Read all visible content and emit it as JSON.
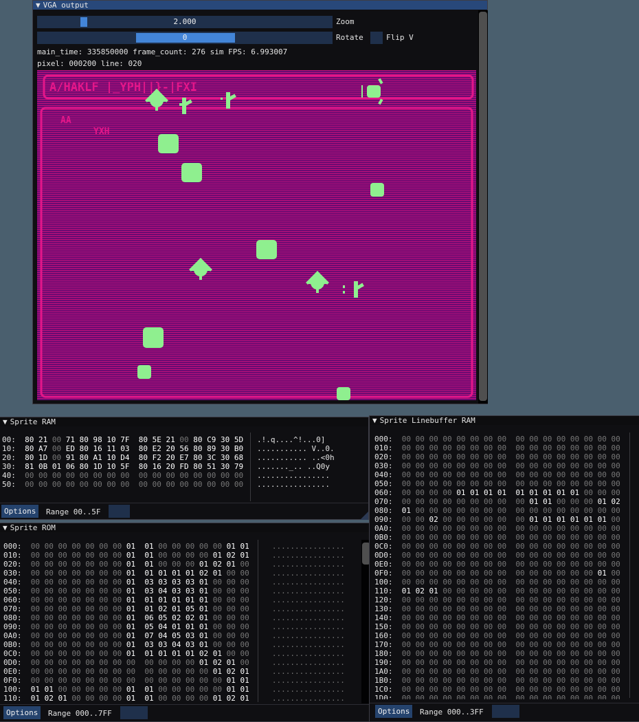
{
  "vga": {
    "title": "VGA output",
    "zoom_value": "2.000",
    "zoom_label": "Zoom",
    "rotate_value": "0",
    "rotate_label": "Rotate",
    "flip_label": "Flip V",
    "status_line": "main_time: 335850000 frame_count: 276 sim FPS: 6.993007",
    "pixel_line": "pixel: 000200 line: 020",
    "header_text": "A/HAKLF |_YPH||}-|FXI",
    "subtext1": "AA",
    "subtext2": "YXH",
    "colors": {
      "bg": "#7a0f6a",
      "border": "#d4147a",
      "sprite": "#8fef8f"
    }
  },
  "sprite_ram": {
    "title": "Sprite RAM",
    "rows": [
      {
        "addr": "00:",
        "bytes": [
          "80",
          "21",
          "00",
          "71",
          "80",
          "98",
          "10",
          "7F",
          "80",
          "5E",
          "21",
          "00",
          "80",
          "C9",
          "30",
          "5D"
        ],
        "ascii": ".!.q....^!...0]"
      },
      {
        "addr": "10:",
        "bytes": [
          "80",
          "A7",
          "00",
          "ED",
          "80",
          "16",
          "11",
          "03",
          "80",
          "E2",
          "20",
          "56",
          "80",
          "89",
          "30",
          "B0"
        ],
        "ascii": "........... V..0."
      },
      {
        "addr": "20:",
        "bytes": [
          "80",
          "1D",
          "00",
          "91",
          "80",
          "A1",
          "10",
          "D4",
          "80",
          "F2",
          "20",
          "E7",
          "80",
          "3C",
          "30",
          "68"
        ],
        "ascii": "........... ..<0h"
      },
      {
        "addr": "30:",
        "bytes": [
          "81",
          "0B",
          "01",
          "06",
          "80",
          "1D",
          "10",
          "5F",
          "80",
          "16",
          "20",
          "FD",
          "80",
          "51",
          "30",
          "79"
        ],
        "ascii": "......._.. ..Q0y"
      },
      {
        "addr": "40:",
        "bytes": [
          "00",
          "00",
          "00",
          "00",
          "00",
          "00",
          "00",
          "00",
          "00",
          "00",
          "00",
          "00",
          "00",
          "00",
          "00",
          "00"
        ],
        "ascii": "................"
      },
      {
        "addr": "50:",
        "bytes": [
          "00",
          "00",
          "00",
          "00",
          "00",
          "00",
          "00",
          "00",
          "00",
          "00",
          "00",
          "00",
          "00",
          "00",
          "00",
          "00"
        ],
        "ascii": "................"
      }
    ],
    "options_label": "Options",
    "range_label": "Range 00..5F"
  },
  "sprite_rom": {
    "title": "Sprite ROM",
    "rows": [
      {
        "addr": "000:",
        "hex": "00 00 00 00 00 00 00 01  01 00 00 00 00 00 01 01",
        "ascii": "................"
      },
      {
        "addr": "010:",
        "hex": "00 00 00 00 00 00 00 01  01 00 00 00 00 01 02 01",
        "ascii": "................"
      },
      {
        "addr": "020:",
        "hex": "00 00 00 00 00 00 00 01  01 00 00 00 01 02 01 00",
        "ascii": "................"
      },
      {
        "addr": "030:",
        "hex": "00 00 00 00 00 00 00 01  01 01 01 01 02 01 00 00",
        "ascii": "................"
      },
      {
        "addr": "040:",
        "hex": "00 00 00 00 00 00 00 01  03 03 03 03 01 00 00 00",
        "ascii": "................"
      },
      {
        "addr": "050:",
        "hex": "00 00 00 00 00 00 00 01  03 04 03 03 01 00 00 00",
        "ascii": "................"
      },
      {
        "addr": "060:",
        "hex": "00 00 00 00 00 00 00 01  01 01 01 01 01 00 00 00",
        "ascii": "................"
      },
      {
        "addr": "070:",
        "hex": "00 00 00 00 00 00 00 01  01 02 01 05 01 00 00 00",
        "ascii": "................"
      },
      {
        "addr": "080:",
        "hex": "00 00 00 00 00 00 00 01  06 05 02 02 01 00 00 00",
        "ascii": "................"
      },
      {
        "addr": "090:",
        "hex": "00 00 00 00 00 00 00 01  05 04 01 01 01 00 00 00",
        "ascii": "................"
      },
      {
        "addr": "0A0:",
        "hex": "00 00 00 00 00 00 00 01  07 04 05 03 01 00 00 00",
        "ascii": "................"
      },
      {
        "addr": "0B0:",
        "hex": "00 00 00 00 00 00 00 01  03 03 04 03 01 00 00 00",
        "ascii": "................"
      },
      {
        "addr": "0C0:",
        "hex": "00 00 00 00 00 00 00 01  01 01 01 01 02 01 00 00",
        "ascii": "................"
      },
      {
        "addr": "0D0:",
        "hex": "00 00 00 00 00 00 00 00  00 00 00 00 01 02 01 00",
        "ascii": "................"
      },
      {
        "addr": "0E0:",
        "hex": "00 00 00 00 00 00 00 00  00 00 00 00 00 01 02 01",
        "ascii": "................"
      },
      {
        "addr": "0F0:",
        "hex": "00 00 00 00 00 00 00 00  00 00 00 00 00 00 01 01",
        "ascii": "................"
      },
      {
        "addr": "100:",
        "hex": "01 01 00 00 00 00 00 01  01 00 00 00 00 00 01 01",
        "ascii": "................"
      },
      {
        "addr": "110:",
        "hex": "01 02 01 00 00 00 00 01  01 00 00 00 00 01 02 01",
        "ascii": "................"
      }
    ],
    "options_label": "Options",
    "range_label": "Range 000..7FF"
  },
  "linebuffer": {
    "title": "Sprite Linebuffer RAM",
    "rows": [
      {
        "addr": "000:",
        "hex": "00 00 00 00 00 00 00 00  00 00 00 00 00 00 00 00"
      },
      {
        "addr": "010:",
        "hex": "00 00 00 00 00 00 00 00  00 00 00 00 00 00 00 00"
      },
      {
        "addr": "020:",
        "hex": "00 00 00 00 00 00 00 00  00 00 00 00 00 00 00 00"
      },
      {
        "addr": "030:",
        "hex": "00 00 00 00 00 00 00 00  00 00 00 00 00 00 00 00"
      },
      {
        "addr": "040:",
        "hex": "00 00 00 00 00 00 00 00  00 00 00 00 00 00 00 00"
      },
      {
        "addr": "050:",
        "hex": "00 00 00 00 00 00 00 00  00 00 00 00 00 00 00 00"
      },
      {
        "addr": "060:",
        "hex": "00 00 00 00 01 01 01 01  01 01 01 01 01 00 00 00"
      },
      {
        "addr": "070:",
        "hex": "00 00 00 00 00 00 00 00  00 01 01 00 00 00 01 02"
      },
      {
        "addr": "080:",
        "hex": "01 00 00 00 00 00 00 00  00 00 00 00 00 00 00 00"
      },
      {
        "addr": "090:",
        "hex": "00 00 02 00 00 00 00 00  00 01 01 01 01 01 01 00"
      },
      {
        "addr": "0A0:",
        "hex": "00 00 00 00 00 00 00 00  00 00 00 00 00 00 00 00"
      },
      {
        "addr": "0B0:",
        "hex": "00 00 00 00 00 00 00 00  00 00 00 00 00 00 00 00"
      },
      {
        "addr": "0C0:",
        "hex": "00 00 00 00 00 00 00 00  00 00 00 00 00 00 00 00"
      },
      {
        "addr": "0D0:",
        "hex": "00 00 00 00 00 00 00 00  00 00 00 00 00 00 00 00"
      },
      {
        "addr": "0E0:",
        "hex": "00 00 00 00 00 00 00 00  00 00 00 00 00 00 00 00"
      },
      {
        "addr": "0F0:",
        "hex": "00 00 00 00 00 00 00 00  00 00 00 00 00 00 01 00"
      },
      {
        "addr": "100:",
        "hex": "00 00 00 00 00 00 00 00  00 00 00 00 00 00 00 00"
      },
      {
        "addr": "110:",
        "hex": "01 02 01 00 00 00 00 00  00 00 00 00 00 00 00 00"
      },
      {
        "addr": "120:",
        "hex": "00 00 00 00 00 00 00 00  00 00 00 00 00 00 00 00"
      },
      {
        "addr": "130:",
        "hex": "00 00 00 00 00 00 00 00  00 00 00 00 00 00 00 00"
      },
      {
        "addr": "140:",
        "hex": "00 00 00 00 00 00 00 00  00 00 00 00 00 00 00 00"
      },
      {
        "addr": "150:",
        "hex": "00 00 00 00 00 00 00 00  00 00 00 00 00 00 00 00"
      },
      {
        "addr": "160:",
        "hex": "00 00 00 00 00 00 00 00  00 00 00 00 00 00 00 00"
      },
      {
        "addr": "170:",
        "hex": "00 00 00 00 00 00 00 00  00 00 00 00 00 00 00 00"
      },
      {
        "addr": "180:",
        "hex": "00 00 00 00 00 00 00 00  00 00 00 00 00 00 00 00"
      },
      {
        "addr": "190:",
        "hex": "00 00 00 00 00 00 00 00  00 00 00 00 00 00 00 00"
      },
      {
        "addr": "1A0:",
        "hex": "00 00 00 00 00 00 00 00  00 00 00 00 00 00 00 00"
      },
      {
        "addr": "1B0:",
        "hex": "00 00 00 00 00 00 00 00  00 00 00 00 00 00 00 00"
      },
      {
        "addr": "1C0:",
        "hex": "00 00 00 00 00 00 00 00  00 00 00 00 00 00 00 00"
      },
      {
        "addr": "1D0:",
        "hex": "00 00 00 00 00 00 00 00  00 00 00 00 00 00 00 00"
      }
    ],
    "options_label": "Options",
    "range_label": "Range 000..3FF"
  }
}
